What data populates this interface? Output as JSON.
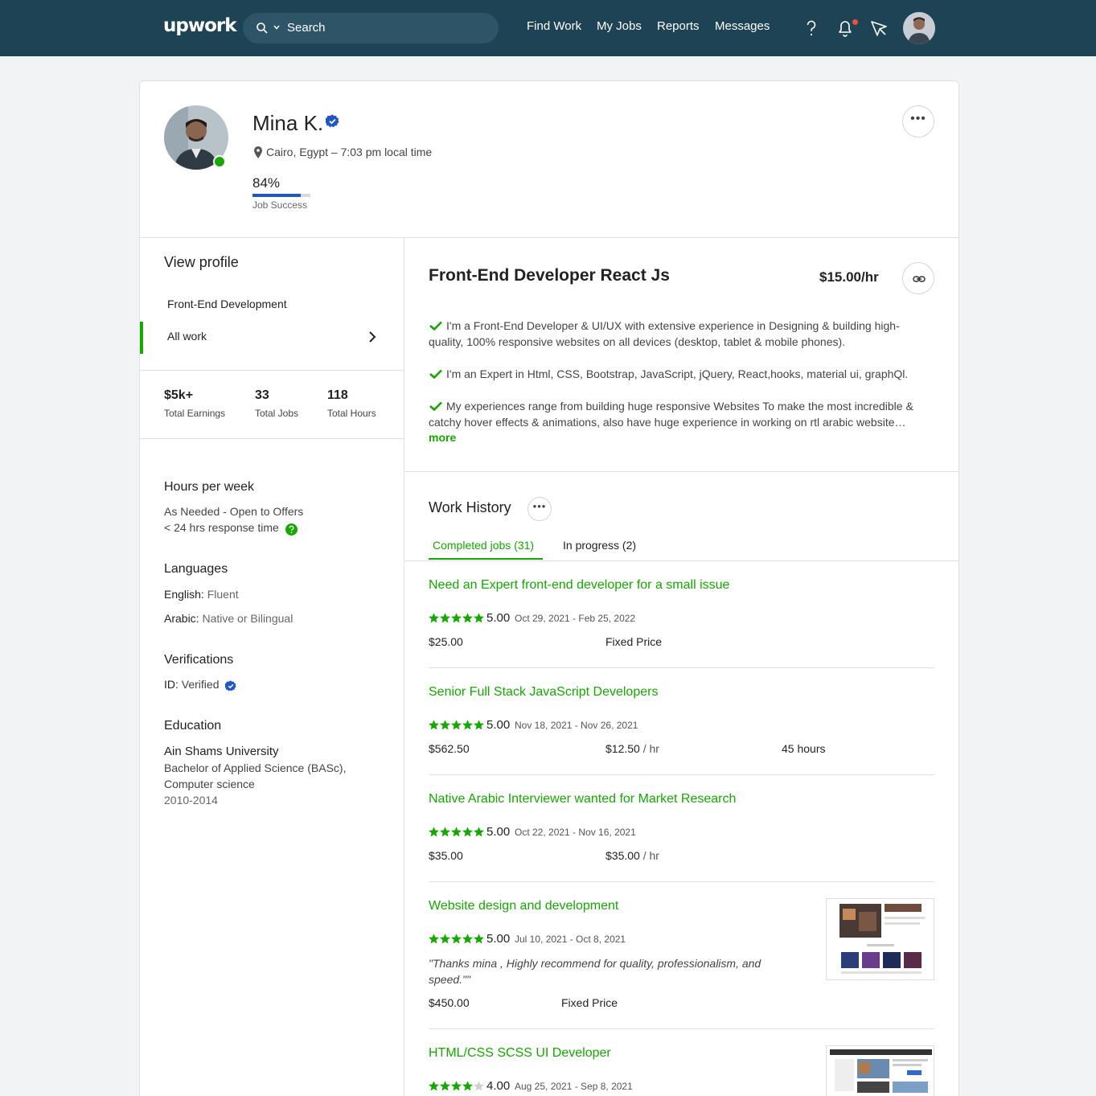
{
  "topbar": {
    "logo": "upwork",
    "search_placeholder": "Search",
    "nav": [
      "Find Work",
      "My Jobs",
      "Reports",
      "Messages"
    ]
  },
  "profile": {
    "name": "Mina K.",
    "location": "Cairo, Egypt – 7:03 pm local time",
    "job_success_pct": "84%",
    "job_success_value": 0.84,
    "job_success_label": "Job Success"
  },
  "sidebar": {
    "view_profile": "View profile",
    "items": [
      "Front-End Development",
      "All work"
    ],
    "stats": [
      {
        "value": "$5k+",
        "label": "Total Earnings"
      },
      {
        "value": "33",
        "label": "Total Jobs"
      },
      {
        "value": "118",
        "label": "Total Hours"
      }
    ],
    "hours_title": "Hours per week",
    "hours_text": "As Needed - Open to Offers",
    "response_text": "< 24 hrs response time",
    "languages_title": "Languages",
    "languages": [
      {
        "name": "English:",
        "level": "Fluent"
      },
      {
        "name": "Arabic:",
        "level": "Native or Bilingual"
      }
    ],
    "verifications_title": "Verifications",
    "id_label": "ID:",
    "id_value": "Verified",
    "education_title": "Education",
    "school": "Ain Shams University",
    "degree_line1": "Bachelor of Applied Science (BASc),",
    "degree_line2": "Computer science",
    "years": "2010-2014"
  },
  "main": {
    "title": "Front-End Developer React Js",
    "rate": "$15.00/hr",
    "bio": [
      "I'm a Front-End Developer & UI/UX with extensive experience in Designing & building high-quality, 100% responsive websites on all devices (desktop, tablet & mobile phones).",
      "I'm an Expert in Html, CSS, Bootstrap, JavaScript, jQuery, React,hooks, material ui, graphQl.",
      "My experiences range from building huge responsive Websites To make the most incredible & catchy hover effects & animations, also have huge experience in working on rtl arabic website…"
    ],
    "more": "more",
    "work_history_title": "Work History",
    "tabs": [
      "Completed jobs (31)",
      "In progress (2)"
    ],
    "jobs": [
      {
        "title": "Need an Expert front-end developer for a small issue",
        "stars": 5,
        "rating": "5.00",
        "dates": "Oct 29, 2021 - Feb 25, 2022",
        "earned": "$25.00",
        "type": "Fixed Price"
      },
      {
        "title": "Senior Full Stack JavaScript Developers",
        "stars": 5,
        "rating": "5.00",
        "dates": "Nov 18, 2021 - Nov 26, 2021",
        "earned": "$562.50",
        "hourly": "$12.50",
        "per": " / hr",
        "hours": "45 hours"
      },
      {
        "title": "Native Arabic Interviewer wanted for Market Research",
        "stars": 5,
        "rating": "5.00",
        "dates": "Oct 22, 2021 - Nov 16, 2021",
        "earned": "$35.00",
        "hourly": "$35.00",
        "per": " / hr"
      },
      {
        "title": "Website design and development",
        "stars": 5,
        "rating": "5.00",
        "dates": "Jul 10, 2021 - Oct 8, 2021",
        "quote": "\"Thanks mina , Highly recommend for quality, professionalism, and speed.\"\"",
        "earned": "$450.00",
        "type": "Fixed Price"
      },
      {
        "title": "HTML/CSS SCSS UI Developer",
        "stars": 4,
        "rating": "4.00",
        "dates": "Aug 25, 2021 - Sep 8, 2021"
      }
    ]
  },
  "colors": {
    "brand_dark": "#1d4354",
    "accent_green": "#14a800",
    "verified_blue": "#1f57c3"
  }
}
